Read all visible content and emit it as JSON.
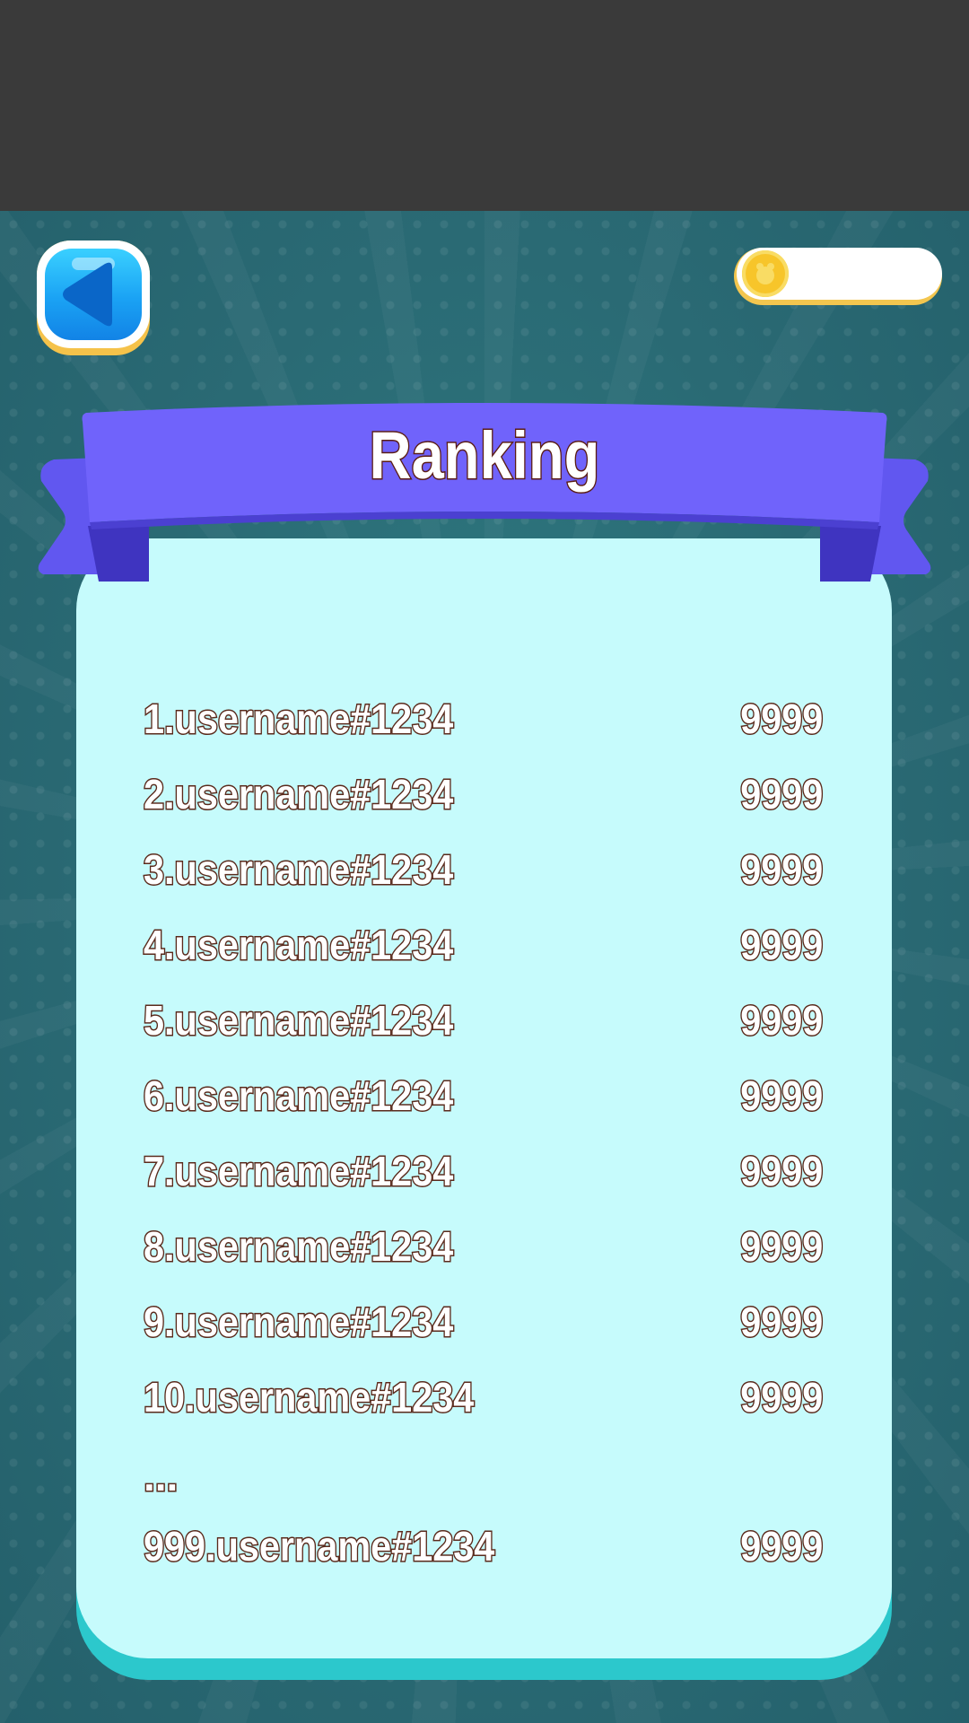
{
  "header": {
    "back_icon": "back-arrow-icon",
    "coin_icon": "coin-icon",
    "coin_value": ""
  },
  "panel": {
    "title": "Ranking"
  },
  "rankings": [
    {
      "label": "1.username#1234",
      "score": "9999"
    },
    {
      "label": "2.username#1234",
      "score": "9999"
    },
    {
      "label": "3.username#1234",
      "score": "9999"
    },
    {
      "label": "4.username#1234",
      "score": "9999"
    },
    {
      "label": "5.username#1234",
      "score": "9999"
    },
    {
      "label": "6.username#1234",
      "score": "9999"
    },
    {
      "label": "7.username#1234",
      "score": "9999"
    },
    {
      "label": "8.username#1234",
      "score": "9999"
    },
    {
      "label": "9.username#1234",
      "score": "9999"
    },
    {
      "label": "10.username#1234",
      "score": "9999"
    }
  ],
  "ellipsis": "...",
  "self_rank": {
    "label": "999.username#1234",
    "score": "9999"
  },
  "colors": {
    "banner": "#7063fb",
    "banner_dark": "#4b40d1",
    "panel": "#c6fbfc",
    "panel_shadow": "#2cc8cc",
    "text_outline": "#5a2a1c",
    "button_blue": "#1aa2f4",
    "coin_yellow": "#f7c52a"
  }
}
